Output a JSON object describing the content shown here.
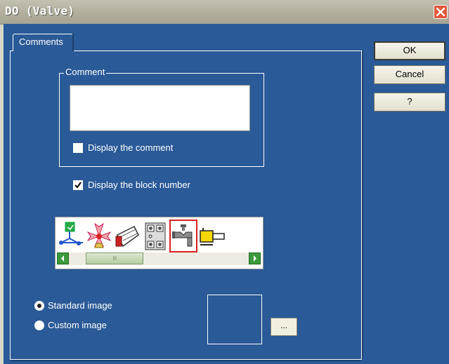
{
  "window": {
    "title": "DO (Valve)"
  },
  "tabs": [
    {
      "label": "Comments"
    }
  ],
  "comment_group": {
    "label": "Comment",
    "value": "",
    "display_comment": {
      "label": "Display the comment",
      "checked": false
    }
  },
  "display_block_number": {
    "label": "Display the block number",
    "checked": true
  },
  "image_strip": {
    "icons": [
      "network-icon",
      "fan-icon",
      "motor-icon",
      "terminal-block-icon",
      "valve-icon",
      "pump-icon"
    ],
    "selected_index": 4,
    "selected_color": "#d81f1f",
    "scroll_thumb_label": "III"
  },
  "image_source": {
    "options": [
      {
        "label": "Standard image",
        "selected": true
      },
      {
        "label": "Custom image",
        "selected": false
      }
    ],
    "browse_label": "..."
  },
  "buttons": {
    "ok": "OK",
    "cancel": "Cancel",
    "help": "?"
  },
  "colors": {
    "panel": "#2a5a97",
    "titlebar": "#b2ae9e",
    "close": "#e2583b"
  }
}
